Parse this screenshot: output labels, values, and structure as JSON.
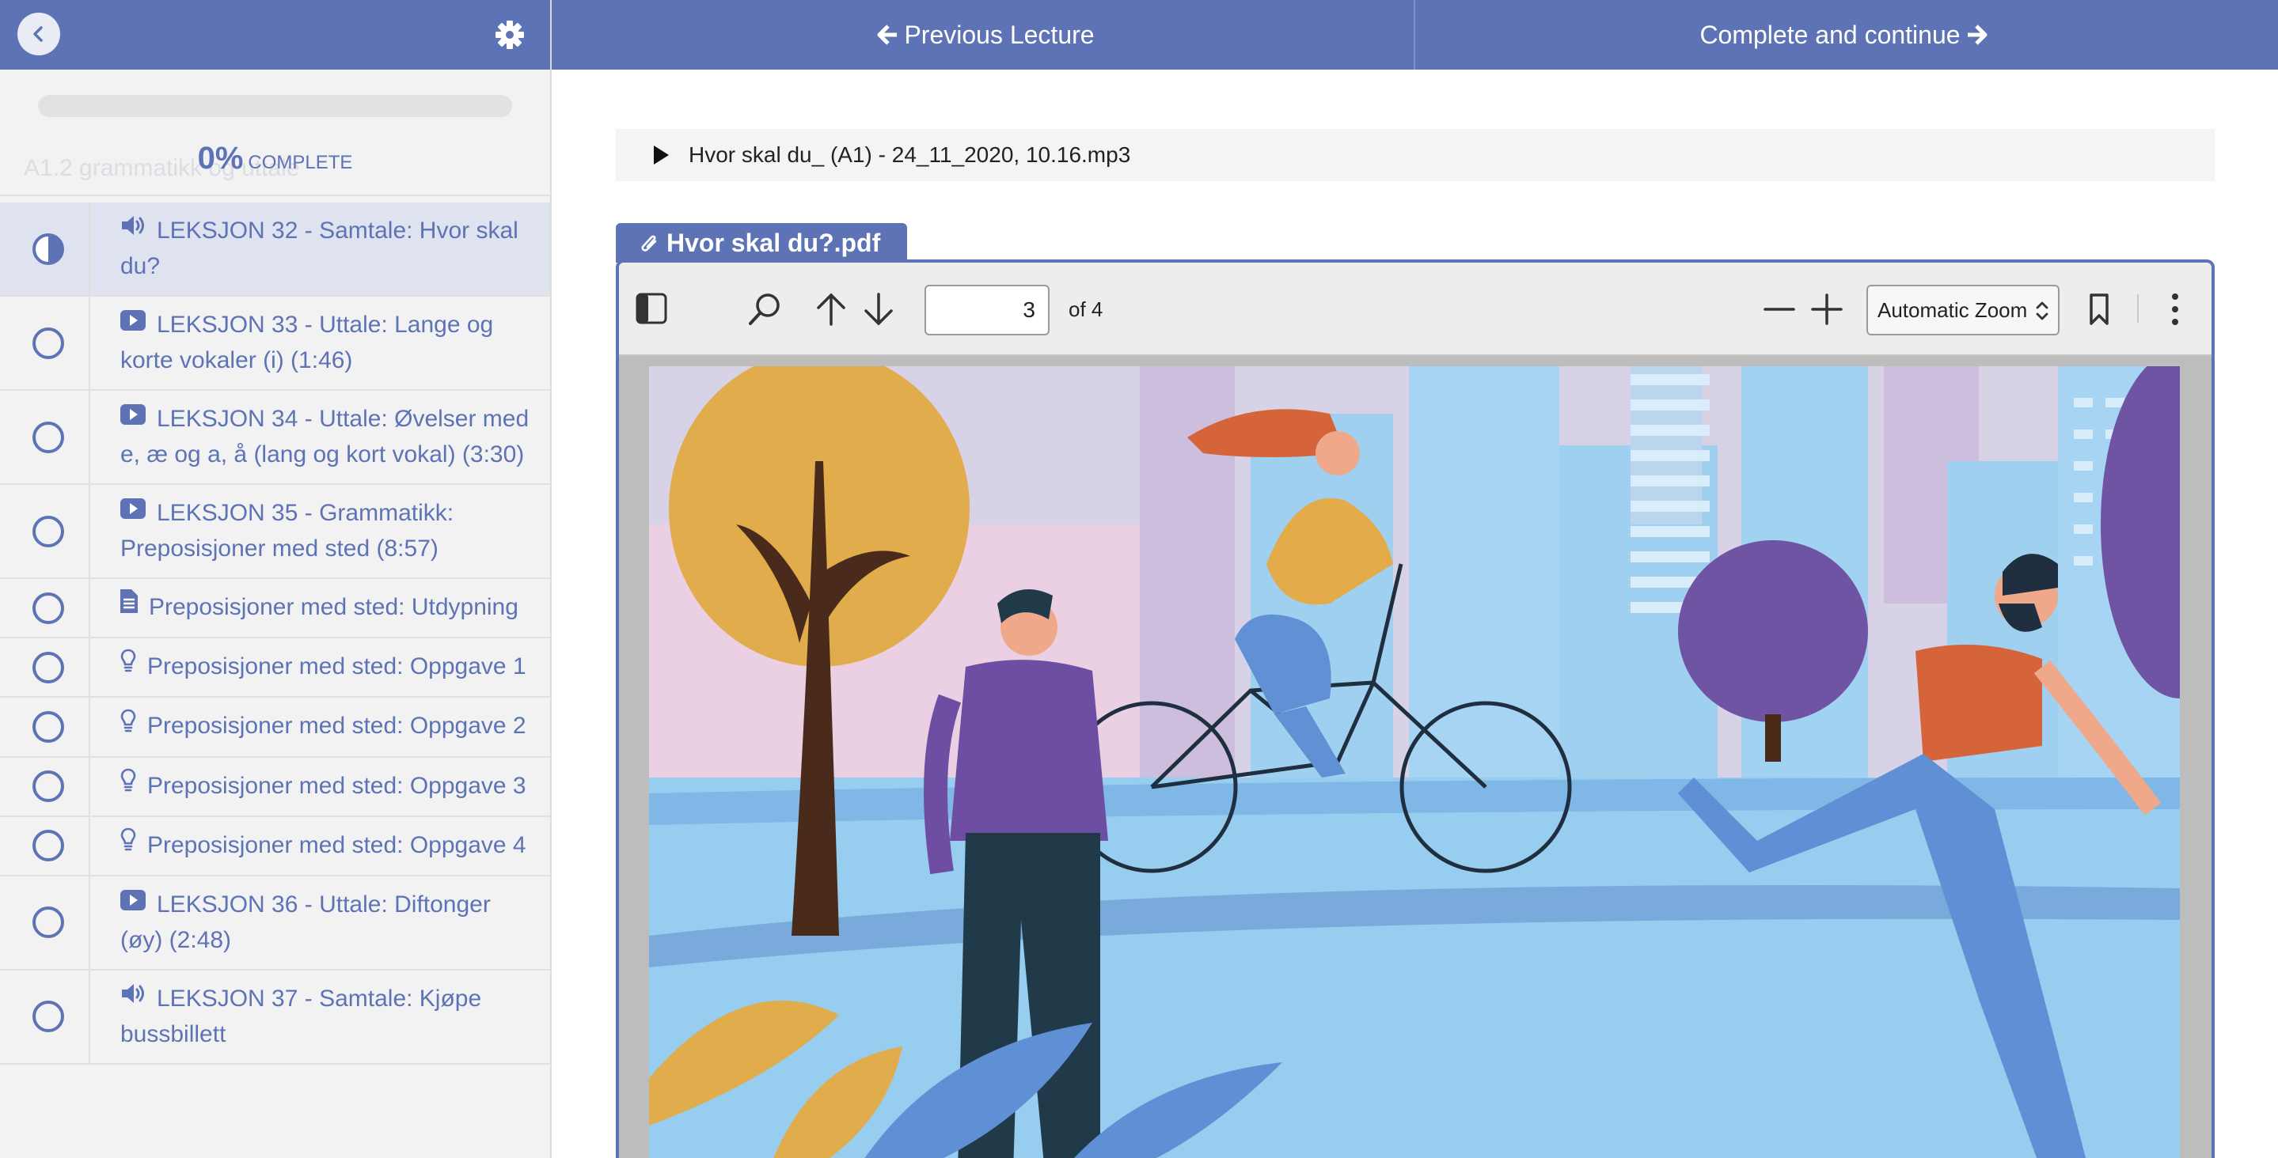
{
  "sidebar": {
    "progress": {
      "percent_value": 0,
      "percent": "0%",
      "complete_word": "COMPLETE"
    },
    "course_title": "A1.2 grammatikk og uttale",
    "lectures": [
      {
        "status": "in-progress",
        "icon": "audio-icon",
        "title": "LEKSJON 32 - Samtale: Hvor skal du?",
        "active": true
      },
      {
        "status": "incomplete",
        "icon": "video-icon",
        "title": "LEKSJON 33 - Uttale: Lange og korte vokaler (i) (1:46)"
      },
      {
        "status": "incomplete",
        "icon": "video-icon",
        "title": "LEKSJON 34 - Uttale: Øvelser med e, æ og a, å (lang og kort vokal) (3:30)"
      },
      {
        "status": "incomplete",
        "icon": "video-icon",
        "title": "LEKSJON 35 - Grammatikk: Preposisjoner med sted (8:57)"
      },
      {
        "status": "incomplete",
        "icon": "text-icon",
        "title": "Preposisjoner med sted: Utdypning"
      },
      {
        "status": "incomplete",
        "icon": "lightbulb-icon",
        "title": "Preposisjoner med sted: Oppgave 1"
      },
      {
        "status": "incomplete",
        "icon": "lightbulb-icon",
        "title": "Preposisjoner med sted: Oppgave 2"
      },
      {
        "status": "incomplete",
        "icon": "lightbulb-icon",
        "title": "Preposisjoner med sted: Oppgave 3"
      },
      {
        "status": "incomplete",
        "icon": "lightbulb-icon",
        "title": "Preposisjoner med sted: Oppgave 4"
      },
      {
        "status": "incomplete",
        "icon": "video-icon",
        "title": "LEKSJON 36 - Uttale: Diftonger (øy) (2:48)"
      },
      {
        "status": "incomplete",
        "icon": "audio-icon",
        "title": "LEKSJON 37 - Samtale: Kjøpe bussbillett"
      }
    ]
  },
  "topbar": {
    "prev_label": "Previous Lecture",
    "next_label": "Complete and continue"
  },
  "audio": {
    "file_name": "Hvor skal du_ (A1) - 24_11_2020, 10.16.mp3"
  },
  "attachment": {
    "file_name": "Hvor skal du?.pdf"
  },
  "pdf_viewer": {
    "page_number": "3",
    "page_total": "of 4",
    "zoom": "Automatic Zoom"
  },
  "colors": {
    "accent": "#5d73b5",
    "sidebar_bg": "#f2f2f2",
    "active_row": "#dfe3ef"
  }
}
